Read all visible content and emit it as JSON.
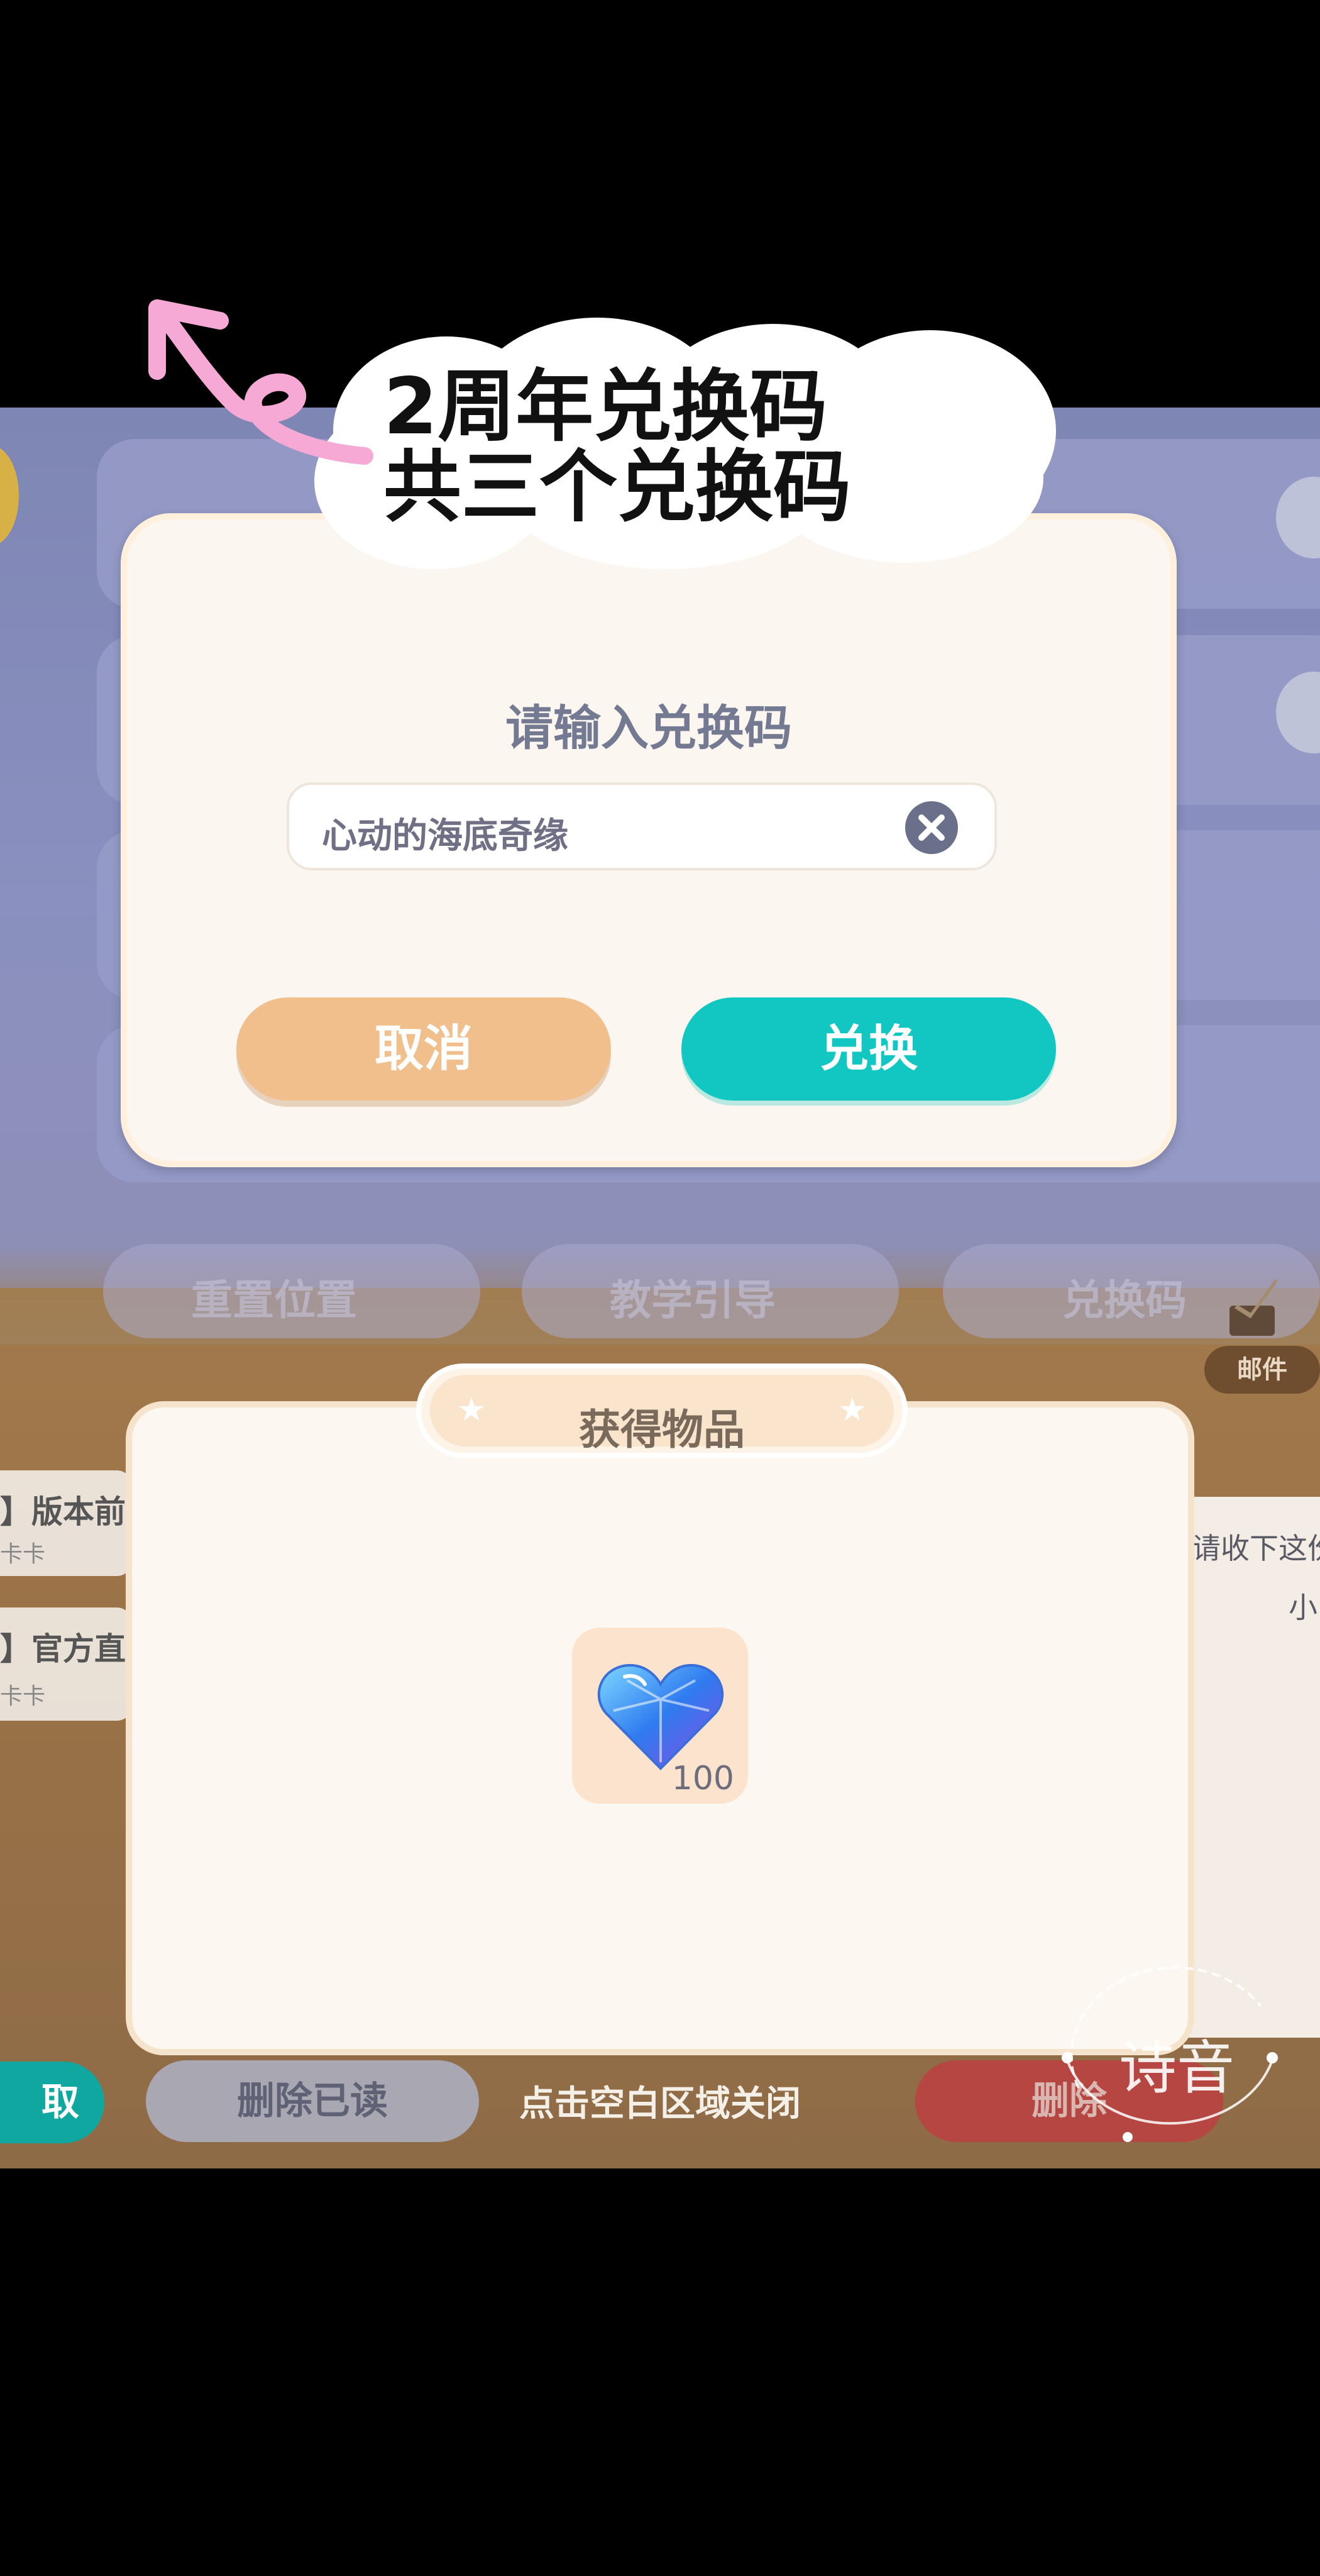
{
  "overlay_caption": {
    "line1": "2周年兑换码",
    "line2": "共三个兑换码"
  },
  "background": {
    "tabs": [
      "重置位置",
      "教学引导",
      "兑换码"
    ],
    "mail_items": [
      {
        "title": "】版本前",
        "subtitle": "卡卡"
      },
      {
        "title": "】官方直",
        "subtitle": "卡卡"
      }
    ],
    "mail_preview": {
      "line1": "请收下这份",
      "line2": "小"
    },
    "mail_tab_label": "邮件"
  },
  "redeem_dialog": {
    "title": "请输入兑换码",
    "code_value": "心动的海底奇缘",
    "cancel_label": "取消",
    "redeem_label": "兑换"
  },
  "items_panel": {
    "title": "获得物品",
    "items": [
      {
        "icon": "blue-heart-crystal-icon",
        "count": "100"
      }
    ]
  },
  "bottom_bar": {
    "collect_label": "取",
    "delete_read_label": "删除已读",
    "close_hint": "点击空白区域关闭",
    "delete_label": "删除"
  },
  "watermark": {
    "text": "诗音"
  },
  "colors": {
    "accent_teal": "#12c7c1",
    "cancel_orange": "#f0bf8c",
    "dialog_bg": "#fbf6ef",
    "caption_arrow_pink": "#f7a9d6"
  }
}
